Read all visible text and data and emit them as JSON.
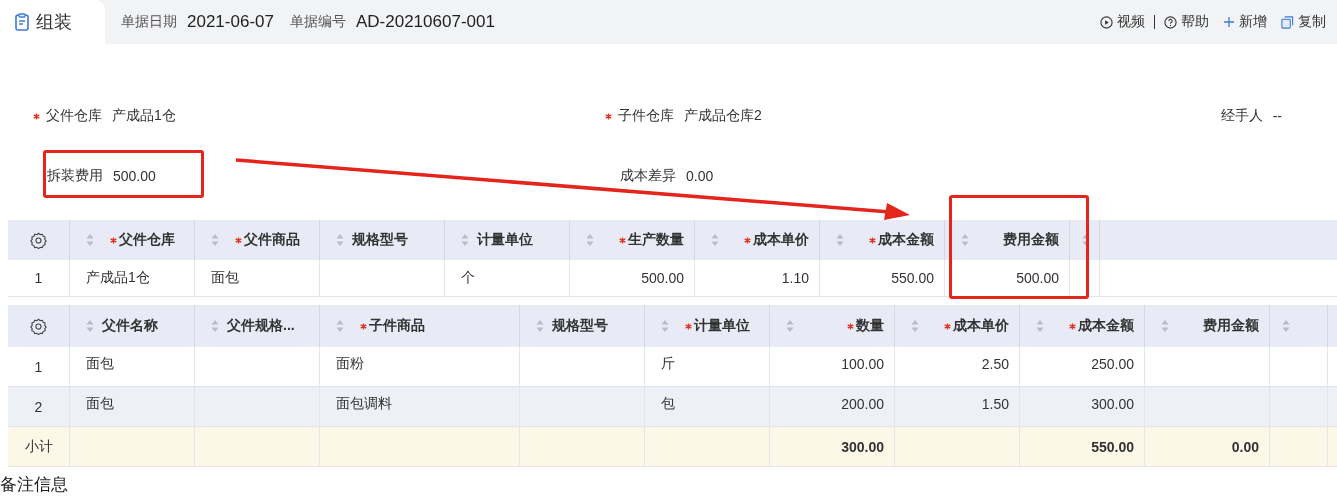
{
  "header": {
    "tab": "组装",
    "fields": [
      {
        "label": "单据日期",
        "value": "2021-06-07"
      },
      {
        "label": "单据编号",
        "value": "AD-20210607-001"
      }
    ],
    "actions": [
      {
        "kind": "video",
        "label": "视频"
      },
      {
        "kind": "help",
        "label": "帮助"
      },
      {
        "kind": "add",
        "label": "新增"
      },
      {
        "kind": "copy",
        "label": "复制"
      }
    ]
  },
  "form": {
    "rows": [
      [
        {
          "label": "父件仓库",
          "value": "产成品1仓",
          "required": true
        },
        {
          "label": "子件仓库",
          "value": "产成品仓库2",
          "required": true
        },
        {
          "label": "经手人",
          "value": "--",
          "required": false
        }
      ],
      [
        {
          "label": "拆装费用",
          "value": "500.00",
          "required": false
        },
        {
          "label": "成本差异",
          "value": "0.00",
          "required": false
        }
      ]
    ]
  },
  "parent_table": {
    "columns": [
      {
        "label": "父件仓库",
        "required": true,
        "kind": "text"
      },
      {
        "label": "父件商品",
        "required": true,
        "kind": "text"
      },
      {
        "label": "规格型号",
        "required": false,
        "kind": "text"
      },
      {
        "label": "计量单位",
        "required": false,
        "kind": "text"
      },
      {
        "label": "生产数量",
        "required": true,
        "kind": "number"
      },
      {
        "label": "成本单价",
        "required": true,
        "kind": "number"
      },
      {
        "label": "成本金额",
        "required": true,
        "kind": "number"
      },
      {
        "label": "费用金额",
        "required": false,
        "kind": "number"
      }
    ],
    "rows": [
      {
        "index": "1",
        "selected": false,
        "cells": [
          "产成品1仓",
          "面包",
          null,
          "个",
          "500.00",
          "1.10",
          "550.00",
          "500.00"
        ]
      }
    ]
  },
  "child_table": {
    "columns": [
      {
        "label": "父件名称",
        "required": false,
        "kind": "text"
      },
      {
        "label": "父件规格...",
        "required": false,
        "kind": "text"
      },
      {
        "label": "子件商品",
        "required": true,
        "kind": "text"
      },
      {
        "label": "规格型号",
        "required": false,
        "kind": "text"
      },
      {
        "label": "计量单位",
        "required": true,
        "kind": "text"
      },
      {
        "label": "数量",
        "required": true,
        "kind": "number"
      },
      {
        "label": "成本单价",
        "required": true,
        "kind": "number"
      },
      {
        "label": "成本金额",
        "required": true,
        "kind": "number"
      },
      {
        "label": "费用金额",
        "required": false,
        "kind": "number"
      }
    ],
    "rows": [
      {
        "index": "1",
        "selected": false,
        "cells": [
          "面包",
          null,
          "面粉",
          null,
          "斤",
          "100.00",
          "2.50",
          "250.00",
          null
        ]
      },
      {
        "index": "2",
        "selected": true,
        "cells": [
          "面包",
          null,
          "面包调料",
          null,
          "包",
          "200.00",
          "1.50",
          "300.00",
          null
        ]
      }
    ],
    "subtotal": {
      "label": "小计",
      "cells": [
        null,
        null,
        null,
        null,
        null,
        "300.00",
        null,
        "550.00",
        "0.00"
      ]
    }
  },
  "remarks_title": "备注信息"
}
